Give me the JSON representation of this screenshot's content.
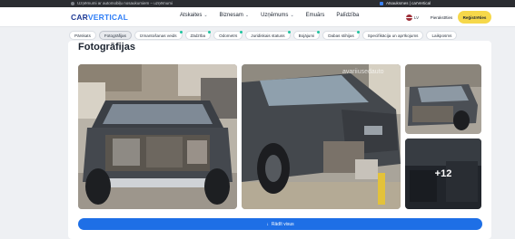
{
  "browser": {
    "left_text": "Uzņēmumi ar automobiļu nosaukumiem – uzņēmumi",
    "right_text": "Atsauksmes | carVertical"
  },
  "header": {
    "logo_main": "CAR",
    "logo_accent": "VERTICAL",
    "nav": [
      {
        "label": "Atskaites",
        "has_chevron": true
      },
      {
        "label": "Biznesam",
        "has_chevron": true
      },
      {
        "label": "Uzņēmums",
        "has_chevron": true
      },
      {
        "label": "Emuārs",
        "has_chevron": false
      },
      {
        "label": "Palīdzība",
        "has_chevron": false
      }
    ],
    "lang": "LV",
    "login_label": "Pierakstīties",
    "register_label": "Reģistrēties"
  },
  "tabs": [
    {
      "label": "Pārskats",
      "active": false,
      "badge": false
    },
    {
      "label": "Fotogrāfijas",
      "active": true,
      "badge": false
    },
    {
      "label": "Izmantošanas veids",
      "active": false,
      "badge": true
    },
    {
      "label": "Zādzība",
      "active": false,
      "badge": true
    },
    {
      "label": "Odometrs",
      "active": false,
      "badge": true
    },
    {
      "label": "Juridiskais statuss",
      "active": false,
      "badge": true
    },
    {
      "label": "Bojājumi",
      "active": false,
      "badge": true
    },
    {
      "label": "Dabas stihijas",
      "active": false,
      "badge": true
    },
    {
      "label": "Specifikācija un aprīkojums",
      "active": false,
      "badge": false
    },
    {
      "label": "Laikposms",
      "active": false,
      "badge": false
    }
  ],
  "section": {
    "title": "Fotogrāfijas",
    "more_count": "+12",
    "watermark": "avariiusedauto",
    "show_all_label": "Rādīt visus"
  },
  "colors": {
    "brand": "#1f3a93",
    "accent": "#2e7df6",
    "cta": "#1e6fe6",
    "register": "#f6d84a",
    "badge": "#21c4a0"
  }
}
